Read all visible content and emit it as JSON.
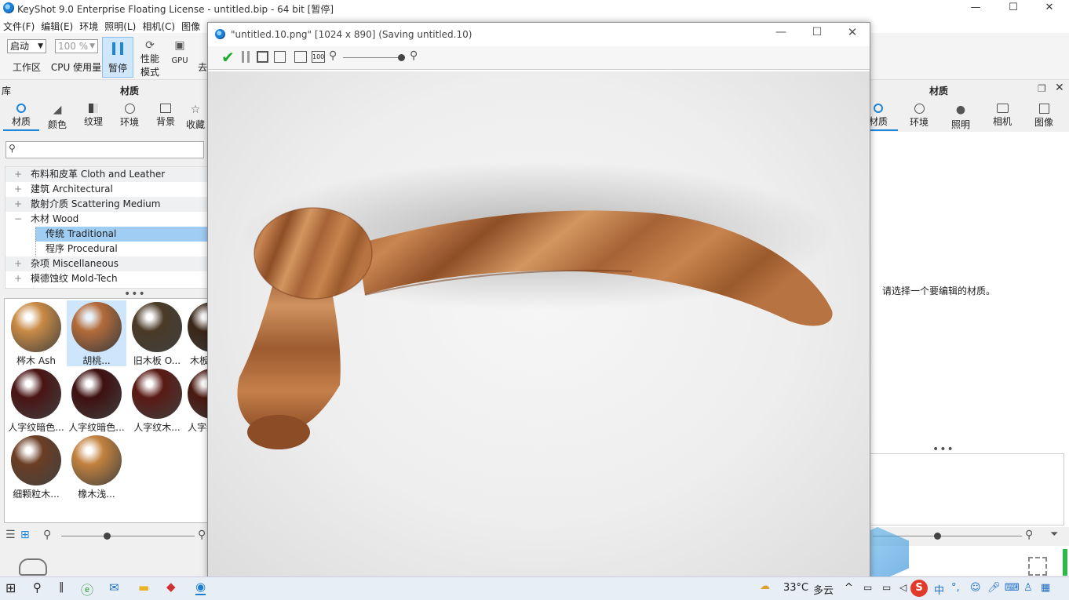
{
  "app": {
    "title": "KeyShot 9.0 Enterprise Floating License  - untitled.bip  - 64 bit [暂停]",
    "min": "—",
    "max": "☐",
    "close": "✕"
  },
  "menu": [
    "文件(F)",
    "编辑(E)",
    "环境",
    "照明(L)",
    "相机(C)",
    "图像"
  ],
  "toolbar": {
    "workspace_select": "启动",
    "workspace_label": "工作区",
    "cpu_select": "100 %",
    "cpu_label": "CPU 使用量",
    "pause_label": "暂停",
    "perf_label_1": "性能",
    "perf_label_2": "模式",
    "gpu_label": "GPU",
    "extra_label": "去"
  },
  "left_panel": {
    "head_left": "库",
    "head_title": "材质",
    "tabs": [
      "材质",
      "颜色",
      "纹理",
      "环境",
      "背景",
      "收藏"
    ],
    "search_placeholder": "",
    "tree": [
      {
        "prefix": "+",
        "label": "布料和皮革 Cloth and Leather"
      },
      {
        "prefix": "+",
        "label": "建筑 Architectural"
      },
      {
        "prefix": "+",
        "label": "散射介质 Scattering Medium"
      },
      {
        "prefix": "−",
        "label": "木材 Wood"
      },
      {
        "prefix": "",
        "label": "传统 Traditional"
      },
      {
        "prefix": "",
        "label": "程序 Procedural"
      },
      {
        "prefix": "+",
        "label": "杂项 Miscellaneous"
      },
      {
        "prefix": "+",
        "label": "模德蚀纹 Mold-Tech"
      }
    ],
    "materials": [
      {
        "label": "梣木 Ash",
        "color": "#c98a45"
      },
      {
        "label": "胡桃...",
        "color": "#b36b3a"
      },
      {
        "label": "旧木板 O...",
        "color": "#4a3a26"
      },
      {
        "label": "木板",
        "color": "#3a2618"
      },
      {
        "label": "人字纹暗色...",
        "color": "#4a1414"
      },
      {
        "label": "人字纹暗色...",
        "color": "#3f1010"
      },
      {
        "label": "人字纹木...",
        "color": "#5a1a14"
      },
      {
        "label": "人字纹",
        "color": "#4a1810"
      },
      {
        "label": "细颗粒木...",
        "color": "#6b3e24"
      },
      {
        "label": "橡木浅...",
        "color": "#c2813e"
      }
    ]
  },
  "right_panel": {
    "head_title": "材质",
    "tabs": [
      "材质",
      "环境",
      "照明",
      "相机",
      "图像"
    ],
    "message": "请选择一个要编辑的材质。"
  },
  "render_window": {
    "title": "\"untitled.10.png\" [1024 x 890] (Saving untitled.10)",
    "zoom_100": "100"
  },
  "taskbar": {
    "weather_temp": "33°C",
    "weather_text": "多云",
    "ime_lang": "中"
  }
}
